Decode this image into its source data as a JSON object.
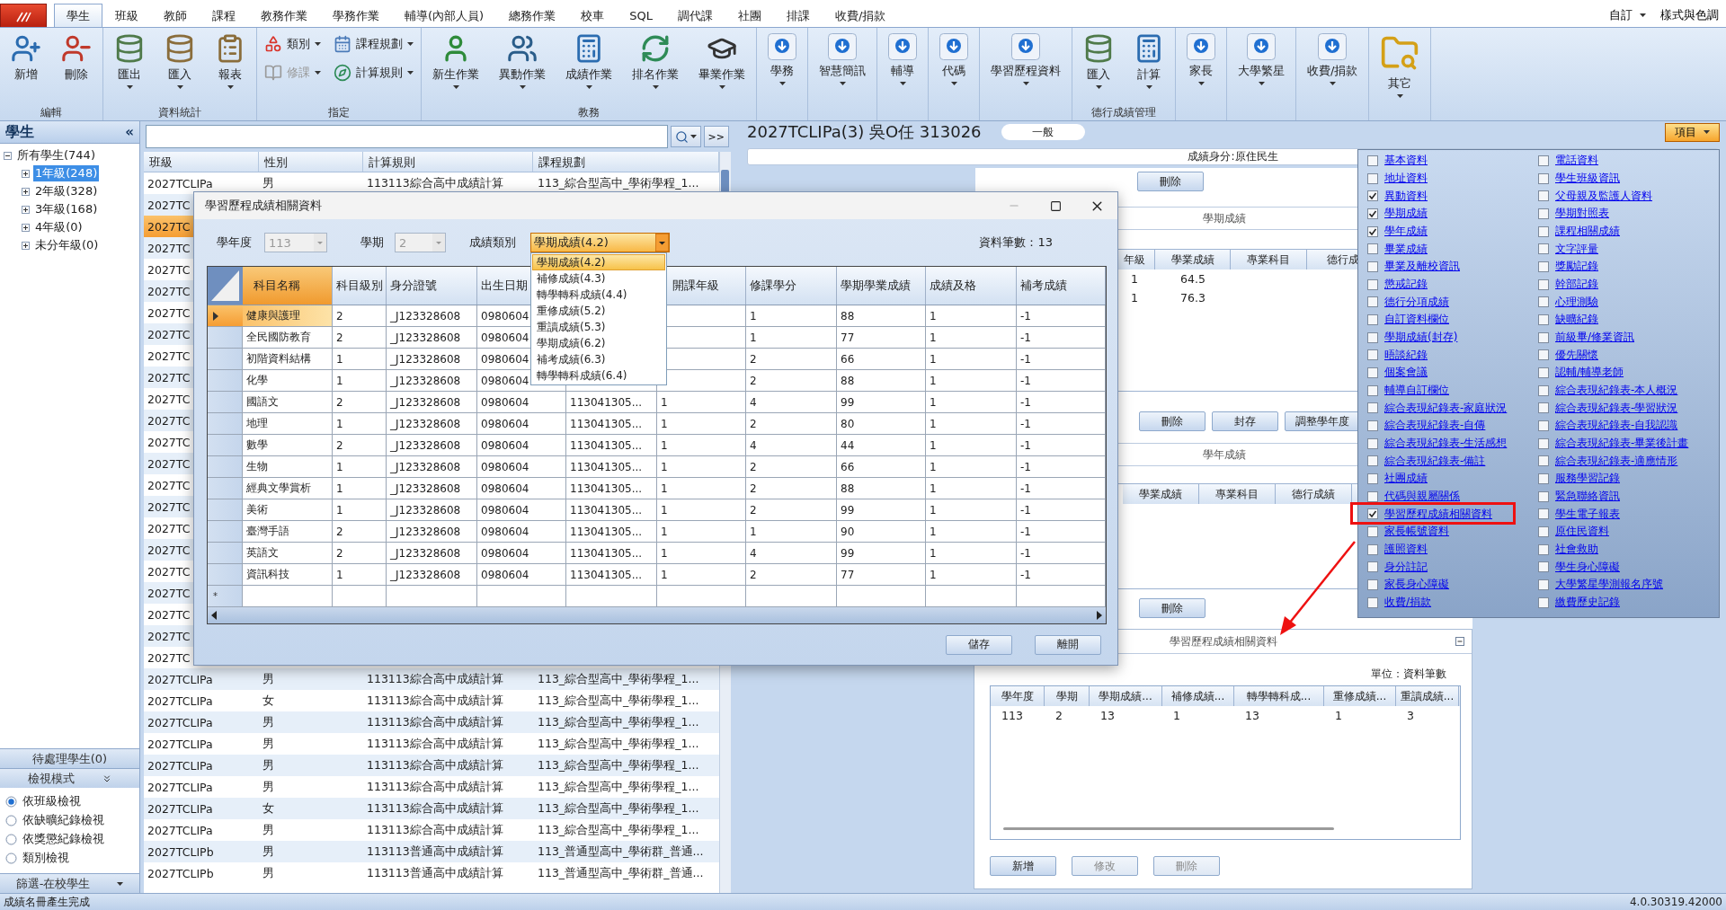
{
  "ribbon": {
    "tabs": [
      {
        "label": "學生",
        "selected": true
      },
      {
        "label": "班級",
        "selected": false
      },
      {
        "label": "教師",
        "selected": false
      },
      {
        "label": "課程",
        "selected": false
      },
      {
        "label": "教務作業",
        "selected": false
      },
      {
        "label": "學務作業",
        "selected": false
      },
      {
        "label": "輔導(內部人員)",
        "selected": false
      },
      {
        "label": "總務作業",
        "selected": false
      },
      {
        "label": "校車",
        "selected": false
      },
      {
        "label": "SQL",
        "selected": false
      },
      {
        "label": "調代課",
        "selected": false
      },
      {
        "label": "社團",
        "selected": false
      },
      {
        "label": "排課",
        "selected": false
      },
      {
        "label": "收費/捐款",
        "selected": false
      }
    ],
    "customize": "自訂",
    "style_menu": "樣式與色調",
    "groups": [
      {
        "label": "編輯",
        "compact": false,
        "buttons": [
          {
            "label": "新增",
            "kind": "user-add",
            "dropdown": false
          },
          {
            "label": "刪除",
            "kind": "user-remove",
            "dropdown": false
          }
        ]
      },
      {
        "label": "資料統計",
        "compact": false,
        "buttons": [
          {
            "label": "匯出",
            "kind": "export",
            "dropdown": true
          },
          {
            "label": "匯入",
            "kind": "import",
            "dropdown": true
          },
          {
            "label": "報表",
            "kind": "report",
            "dropdown": true
          }
        ]
      },
      {
        "label": "指定",
        "compact": true,
        "buttons": [
          {
            "label": "類別",
            "kind": "category",
            "dropdown": true,
            "disabled": false
          },
          {
            "label": "修課",
            "kind": "book",
            "dropdown": true,
            "disabled": true
          },
          {
            "label": "課程規劃",
            "kind": "plan",
            "dropdown": true,
            "disabled": false
          },
          {
            "label": "計算規則",
            "kind": "rule",
            "dropdown": true,
            "disabled": false
          }
        ]
      },
      {
        "label": "教務",
        "compact": false,
        "buttons": [
          {
            "label": "新生作業",
            "kind": "student",
            "dropdown": true
          },
          {
            "label": "異動作業",
            "kind": "transfer",
            "dropdown": true
          },
          {
            "label": "成績作業",
            "kind": "calc",
            "dropdown": true
          },
          {
            "label": "排名作業",
            "kind": "rank",
            "dropdown": true
          },
          {
            "label": "畢業作業",
            "kind": "graduate",
            "dropdown": true
          }
        ]
      },
      {
        "compact": false,
        "buttons": [
          {
            "label": "學務",
            "kind": "down",
            "dropdown": true
          }
        ]
      },
      {
        "compact": false,
        "buttons": [
          {
            "label": "智慧簡訊",
            "kind": "down",
            "dropdown": true
          }
        ]
      },
      {
        "compact": false,
        "buttons": [
          {
            "label": "輔導",
            "kind": "down",
            "dropdown": true
          }
        ]
      },
      {
        "compact": false,
        "buttons": [
          {
            "label": "代碼",
            "kind": "down",
            "dropdown": true
          }
        ]
      },
      {
        "compact": false,
        "buttons": [
          {
            "label": "學習歷程資料",
            "kind": "down",
            "dropdown": true
          }
        ]
      },
      {
        "label": "德行成績管理",
        "compact": false,
        "buttons": [
          {
            "label": "匯入",
            "kind": "export",
            "dropdown": true
          },
          {
            "label": "計算",
            "kind": "calc",
            "dropdown": true
          }
        ]
      },
      {
        "compact": false,
        "buttons": [
          {
            "label": "家長",
            "kind": "down",
            "dropdown": true
          }
        ]
      },
      {
        "compact": false,
        "buttons": [
          {
            "label": "大學繁星",
            "kind": "down",
            "dropdown": true
          }
        ]
      },
      {
        "compact": false,
        "buttons": [
          {
            "label": "收費/捐款",
            "kind": "down",
            "dropdown": true
          }
        ]
      },
      {
        "compact": false,
        "buttons": [
          {
            "label": "其它",
            "kind": "folder",
            "dropdown": true
          }
        ]
      }
    ]
  },
  "left_panel": {
    "title": "學生",
    "collapse": "«",
    "tree": {
      "label": "所有學生(744)",
      "expanded": true,
      "selected": false,
      "children": [
        {
          "label": "1年級(248)",
          "selected": true,
          "expanded": false
        },
        {
          "label": "2年級(328)",
          "selected": false,
          "expanded": false
        },
        {
          "label": "3年級(168)",
          "selected": false,
          "expanded": false
        },
        {
          "label": "4年級(0)",
          "selected": false,
          "expanded": false
        },
        {
          "label": "未分年級(0)",
          "selected": false,
          "expanded": false
        }
      ]
    },
    "pending": "待處理學生(0)",
    "view_mode": {
      "title": "檢視模式",
      "options": [
        {
          "label": "依班級檢視",
          "selected": true
        },
        {
          "label": "依缺曠紀錄檢視",
          "selected": false
        },
        {
          "label": "依獎懲紀錄檢視",
          "selected": false
        },
        {
          "label": "類別檢視",
          "selected": false
        }
      ]
    },
    "filter": "篩選-在校學生"
  },
  "student_list": {
    "next_button": ">>",
    "columns": [
      "班級",
      "性別",
      "計算規則",
      "課程規劃"
    ],
    "rows": [
      {
        "class": "2027TCLIPa",
        "gender": "男",
        "rule": "113113綜合高中成績計算",
        "plan": "113_綜合型高中_學術學程_1...",
        "selected": false
      },
      {
        "class": "2027TC",
        "selected": false
      },
      {
        "class": "2027TC",
        "selected": true
      },
      {
        "class": "2027TC",
        "selected": false
      },
      {
        "class": "2027TC",
        "selected": false
      },
      {
        "class": "2027TC",
        "selected": false
      },
      {
        "class": "2027TC",
        "selected": false
      },
      {
        "class": "2027TC",
        "selected": false
      },
      {
        "class": "2027TC",
        "selected": false
      },
      {
        "class": "2027TC",
        "selected": false
      },
      {
        "class": "2027TC",
        "selected": false
      },
      {
        "class": "2027TC",
        "selected": false
      },
      {
        "class": "2027TC",
        "selected": false
      },
      {
        "class": "2027TC",
        "selected": false
      },
      {
        "class": "2027TC",
        "selected": false
      },
      {
        "class": "2027TC",
        "selected": false
      },
      {
        "class": "2027TC",
        "selected": false
      },
      {
        "class": "2027TC",
        "selected": false
      },
      {
        "class": "2027TC",
        "selected": false
      },
      {
        "class": "2027TC",
        "selected": false
      },
      {
        "class": "2027TC",
        "selected": false
      },
      {
        "class": "2027TC",
        "selected": false
      },
      {
        "class": "2027TC",
        "selected": false
      },
      {
        "class": "2027TCLIPa",
        "gender": "男",
        "rule": "113113綜合高中成績計算",
        "plan": "113_綜合型高中_學術學程_1...",
        "selected": false
      },
      {
        "class": "2027TCLIPa",
        "gender": "女",
        "rule": "113113綜合高中成績計算",
        "plan": "113_綜合型高中_學術學程_1...",
        "selected": false
      },
      {
        "class": "2027TCLIPa",
        "gender": "男",
        "rule": "113113綜合高中成績計算",
        "plan": "113_綜合型高中_學術學程_1...",
        "selected": false
      },
      {
        "class": "2027TCLIPa",
        "gender": "男",
        "rule": "113113綜合高中成績計算",
        "plan": "113_綜合型高中_學術學程_1...",
        "selected": false
      },
      {
        "class": "2027TCLIPa",
        "gender": "男",
        "rule": "113113綜合高中成績計算",
        "plan": "113_綜合型高中_學術學程_1...",
        "selected": false
      },
      {
        "class": "2027TCLIPa",
        "gender": "男",
        "rule": "113113綜合高中成績計算",
        "plan": "113_綜合型高中_學術學程_1...",
        "selected": false
      },
      {
        "class": "2027TCLIPa",
        "gender": "女",
        "rule": "113113綜合高中成績計算",
        "plan": "113_綜合型高中_學術學程_1...",
        "selected": false
      },
      {
        "class": "2027TCLIPa",
        "gender": "男",
        "rule": "113113綜合高中成績計算",
        "plan": "113_綜合型高中_學術學程_1...",
        "selected": false
      },
      {
        "class": "2027TCLIPb",
        "gender": "男",
        "rule": "113113普通高中成績計算",
        "plan": "113_普通型高中_學術群_普通...",
        "selected": false
      },
      {
        "class": "2027TCLIPb",
        "gender": "男",
        "rule": "113113普通高中成績計算",
        "plan": "113_普通型高中_學術群_普通...",
        "selected": false
      }
    ]
  },
  "detail": {
    "title": "2027TCLIPa(3) 吳O任 313026",
    "tag": "一般",
    "items_button": "項目",
    "identity": "成績身分:原住民生",
    "semester": {
      "buttons": [
        "刪除"
      ],
      "title": "學期成績",
      "columns": [
        "年級",
        "學業成績",
        "專業科目",
        "德行成"
      ],
      "rows": [
        [
          "1",
          "64.5"
        ],
        [
          "1",
          "76.3"
        ]
      ]
    },
    "year": {
      "buttons": [
        "刪除",
        "封存",
        "調整學年度"
      ],
      "title": "學年成績",
      "columns": [
        "學業成績",
        "專業科目",
        "德行成績"
      ],
      "buttons_below": [
        "刪除"
      ]
    },
    "portfolio": {
      "title": "學習歷程成績相關資料",
      "unit": "單位：資料筆數",
      "columns": [
        "學年度",
        "學期",
        "學期成績...",
        "補修成績...",
        "轉學轉科成...",
        "重修成績...",
        "重讀成績..."
      ],
      "rows": [
        [
          "113",
          "2",
          "13",
          "1",
          "13",
          "1",
          "3"
        ]
      ],
      "buttons": [
        {
          "label": "新增",
          "disabled": false
        },
        {
          "label": "修改",
          "disabled": true
        },
        {
          "label": "刪除",
          "disabled": true
        }
      ]
    }
  },
  "checklist": {
    "columns": [
      {
        "items": [
          {
            "label": "基本資料",
            "checked": false
          },
          {
            "label": "地址資料",
            "checked": false
          },
          {
            "label": "異動資料",
            "checked": true
          },
          {
            "label": "學期成績",
            "checked": true
          },
          {
            "label": "學年成績",
            "checked": true
          },
          {
            "label": "畢業成績",
            "checked": false
          },
          {
            "label": "畢業及離校資訊",
            "checked": false
          },
          {
            "label": "懲戒記錄",
            "checked": false
          },
          {
            "label": "德行分項成績",
            "checked": false
          },
          {
            "label": "自訂資料欄位",
            "checked": false
          },
          {
            "label": "學期成績(封存)",
            "checked": false
          },
          {
            "label": "晤談紀錄",
            "checked": false
          },
          {
            "label": "個案會議",
            "checked": false
          },
          {
            "label": "輔導自訂欄位",
            "checked": false
          },
          {
            "label": "綜合表現紀錄表-家庭狀況",
            "checked": false
          },
          {
            "label": "綜合表現紀錄表-自傳",
            "checked": false
          },
          {
            "label": "綜合表現紀錄表-生活感想",
            "checked": false
          },
          {
            "label": "綜合表現紀錄表-備註",
            "checked": false
          },
          {
            "label": "社團成績",
            "checked": false
          },
          {
            "label": "代碼與親屬關係",
            "checked": false
          },
          {
            "label": "學習歷程成績相關資料",
            "checked": true
          },
          {
            "label": "家長帳號資料",
            "checked": false
          },
          {
            "label": "護照資料",
            "checked": false
          },
          {
            "label": "身分註記",
            "checked": false
          },
          {
            "label": "家長身心障礙",
            "checked": false
          },
          {
            "label": "收費/捐款",
            "checked": false
          }
        ]
      },
      {
        "items": [
          {
            "label": "電話資料",
            "checked": false
          },
          {
            "label": "學生班級資訊",
            "checked": false
          },
          {
            "label": "父母親及監護人資料",
            "checked": false
          },
          {
            "label": "學期對照表",
            "checked": false
          },
          {
            "label": "課程相關成績",
            "checked": false
          },
          {
            "label": "文字評量",
            "checked": false
          },
          {
            "label": "獎勵記錄",
            "checked": false
          },
          {
            "label": "幹部記錄",
            "checked": false
          },
          {
            "label": "心理測驗",
            "checked": false
          },
          {
            "label": "缺曠紀錄",
            "checked": false
          },
          {
            "label": "前級畢/修業資訊",
            "checked": false
          },
          {
            "label": "優先關懷",
            "checked": false
          },
          {
            "label": "認輔/輔導老師",
            "checked": false
          },
          {
            "label": "綜合表現紀錄表-本人概況",
            "checked": false
          },
          {
            "label": "綜合表現紀錄表-學習狀況",
            "checked": false
          },
          {
            "label": "綜合表現紀錄表-自我認識",
            "checked": false
          },
          {
            "label": "綜合表現紀錄表-畢業後計畫",
            "checked": false
          },
          {
            "label": "綜合表現紀錄表-適應情形",
            "checked": false
          },
          {
            "label": "服務學習記錄",
            "checked": false
          },
          {
            "label": "緊急聯絡資訊",
            "checked": false
          },
          {
            "label": "學生電子報表",
            "checked": false
          },
          {
            "label": "原住民資料",
            "checked": false
          },
          {
            "label": "社會救助",
            "checked": false
          },
          {
            "label": "學生身心障礙",
            "checked": false
          },
          {
            "label": "大學繁星學測報名序號",
            "checked": false
          },
          {
            "label": "繳費歷史記錄",
            "checked": false
          }
        ]
      }
    ]
  },
  "dialog": {
    "title": "學習歷程成績相關資料",
    "year": {
      "label": "學年度",
      "value": "113",
      "disabled": true
    },
    "term": {
      "label": "學期",
      "value": "2",
      "disabled": true
    },
    "category": {
      "label": "成績類別",
      "value": "學期成績(4.2)",
      "expanded": true,
      "options": [
        {
          "label": "學期成績(4.2)",
          "selected": true
        },
        {
          "label": "補修成績(4.3)",
          "selected": false
        },
        {
          "label": "轉學轉科成績(4.4)",
          "selected": false
        },
        {
          "label": "重修成績(5.2)",
          "selected": false
        },
        {
          "label": "重讀成績(5.3)",
          "selected": false
        },
        {
          "label": "學期成績(6.2)",
          "selected": false
        },
        {
          "label": "補考成績(6.3)",
          "selected": false
        },
        {
          "label": "轉學轉科成績(6.4)",
          "selected": false
        }
      ]
    },
    "count": "資料筆數：13",
    "columns": [
      {
        "label": "科目名稱",
        "sorted": true
      },
      {
        "label": "科目級別",
        "sorted": false
      },
      {
        "label": "身分證號",
        "sorted": false
      },
      {
        "label": "出生日期",
        "sorted": false
      },
      {},
      {
        "label": "開課年級",
        "sorted": false
      },
      {
        "label": "修課學分",
        "sorted": false
      },
      {
        "label": "學期學業成績",
        "sorted": false
      },
      {
        "label": "成績及格",
        "sorted": false
      },
      {
        "label": "補考成績",
        "sorted": false
      }
    ],
    "rows": [
      {
        "selected": true,
        "cells": [
          "健康與護理",
          "2",
          "_J123328608",
          "0980604",
          null,
          null,
          "1",
          "88",
          "1",
          "-1"
        ]
      },
      {
        "selected": false,
        "cells": [
          "全民國防教育",
          "2",
          "_J123328608",
          "0980604",
          null,
          null,
          "1",
          "77",
          "1",
          "-1"
        ]
      },
      {
        "selected": false,
        "cells": [
          "初階資料結構",
          "1",
          "_J123328608",
          "0980604",
          null,
          null,
          "2",
          "66",
          "1",
          "-1"
        ]
      },
      {
        "selected": false,
        "cells": [
          "化學",
          "1",
          "_J123328608",
          "0980604",
          null,
          null,
          "2",
          "88",
          "1",
          "-1"
        ]
      },
      {
        "selected": false,
        "cells": [
          "國語文",
          "2",
          "_J123328608",
          "0980604",
          "113041305...",
          "1",
          "4",
          "99",
          "1",
          "-1"
        ]
      },
      {
        "selected": false,
        "cells": [
          "地理",
          "1",
          "_J123328608",
          "0980604",
          "113041305...",
          "1",
          "2",
          "80",
          "1",
          "-1"
        ]
      },
      {
        "selected": false,
        "cells": [
          "數學",
          "2",
          "_J123328608",
          "0980604",
          "113041305...",
          "1",
          "4",
          "44",
          "1",
          "-1"
        ]
      },
      {
        "selected": false,
        "cells": [
          "生物",
          "1",
          "_J123328608",
          "0980604",
          "113041305...",
          "1",
          "2",
          "66",
          "1",
          "-1"
        ]
      },
      {
        "selected": false,
        "cells": [
          "經典文學賞析",
          "1",
          "_J123328608",
          "0980604",
          "113041305...",
          "1",
          "2",
          "88",
          "1",
          "-1"
        ]
      },
      {
        "selected": false,
        "cells": [
          "美術",
          "1",
          "_J123328608",
          "0980604",
          "113041305...",
          "1",
          "2",
          "99",
          "1",
          "-1"
        ]
      },
      {
        "selected": false,
        "cells": [
          "臺灣手語",
          "2",
          "_J123328608",
          "0980604",
          "113041305...",
          "1",
          "1",
          "90",
          "1",
          "-1"
        ]
      },
      {
        "selected": false,
        "cells": [
          "英語文",
          "2",
          "_J123328608",
          "0980604",
          "113041305...",
          "1",
          "4",
          "99",
          "1",
          "-1"
        ]
      },
      {
        "selected": false,
        "cells": [
          "資訊科技",
          "1",
          "_J123328608",
          "0980604",
          "113041305...",
          "1",
          "2",
          "77",
          "1",
          "-1"
        ]
      }
    ],
    "new_row_marker": "*",
    "buttons": [
      "儲存",
      "離開"
    ]
  },
  "status_bar": {
    "message": "成績名冊產生完成",
    "version": "4.0.30319.42000"
  }
}
